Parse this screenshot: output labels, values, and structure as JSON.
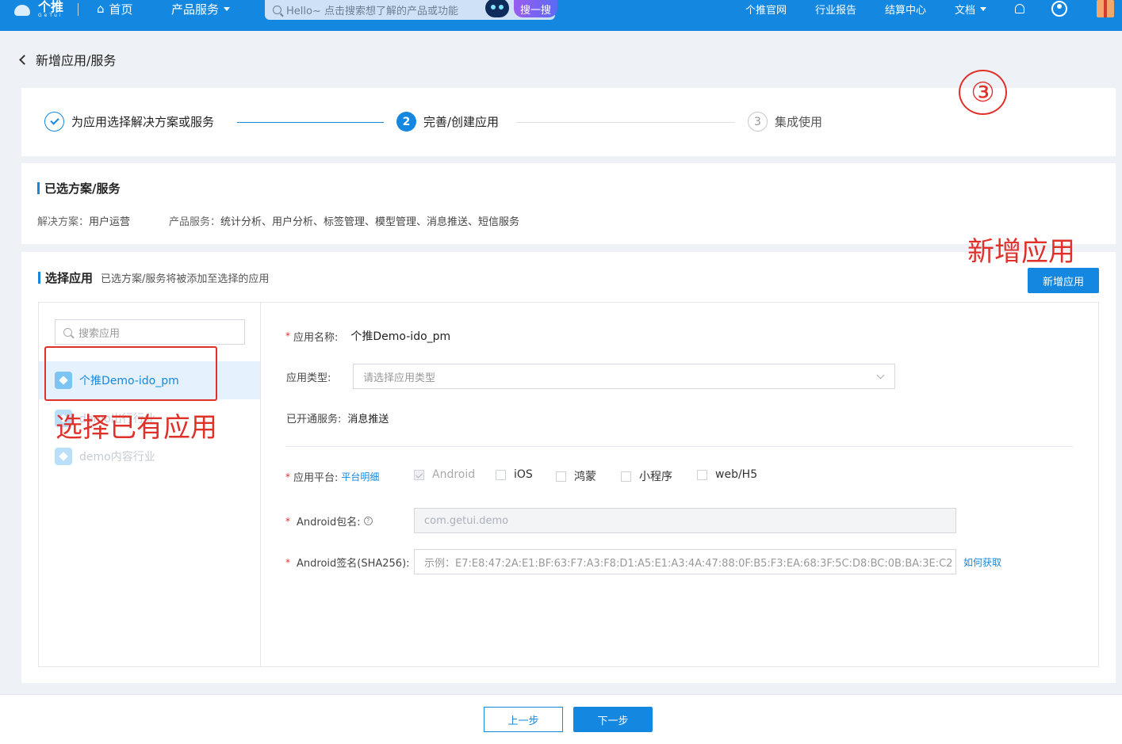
{
  "topnav": {
    "logo_cn": "个推",
    "logo_en": "GeTui",
    "home": "首页",
    "product": "产品服务",
    "search_placeholder": "Hello~ 点击搜索想了解的产品或功能",
    "search_button": "搜一搜",
    "links": [
      "个推官网",
      "行业报告",
      "结算中心",
      "文档"
    ]
  },
  "page": {
    "back_title": "新增应用/服务"
  },
  "steps": [
    {
      "label": "为应用选择解决方案或服务",
      "status": "done"
    },
    {
      "number": "2",
      "label": "完善/创建应用",
      "status": "active"
    },
    {
      "number": "3",
      "label": "集成使用",
      "status": "todo"
    }
  ],
  "annotations": {
    "circled_number": "③",
    "add_app": "新增应用",
    "select_existing": "选择已有应用"
  },
  "selected": {
    "title": "已选方案/服务",
    "solution_label": "解决方案：",
    "solution_value": "用户运营",
    "product_label": "产品服务：",
    "product_value": "统计分析、用户分析、标签管理、模型管理、消息推送、短信服务"
  },
  "select_app": {
    "title": "选择应用",
    "subtitle": "已选方案/服务将被添加至选择的应用",
    "add_button": "新增应用",
    "search_placeholder": "搜索应用",
    "apps": [
      {
        "name": "个推Demo-ido_pm",
        "state": "active"
      },
      {
        "name": "demo出行行业",
        "state": "dim"
      },
      {
        "name": "demo内容行业",
        "state": "dim"
      }
    ]
  },
  "form": {
    "app_name_label": "应用名称:",
    "app_name_value": "个推Demo-ido_pm",
    "app_type_label": "应用类型:",
    "app_type_placeholder": "请选择应用类型",
    "opened_label": "已开通服务:",
    "opened_value": "消息推送",
    "platform_label": "应用平台:",
    "platform_link": "平台明细",
    "platforms": [
      "Android",
      "iOS",
      "鸿蒙",
      "小程序",
      "web/H5"
    ],
    "pkg_label": "Android包名:",
    "pkg_value": "com.getui.demo",
    "sign_label": "Android签名(SHA256):",
    "sign_placeholder": "示例：E7:E8:47:2A:E1:BF:63:F7:A3:F8:D1:A5:E1:A3:4A:47:88:0F:B5:F3:EA:68:3F:5C:D8:BC:0B:BA:3E:C2",
    "sign_link": "如何获取"
  },
  "footer": {
    "prev": "上一步",
    "next": "下一步"
  },
  "colors": {
    "primary": "#1488e0",
    "annotation_red": "#e0302a"
  }
}
